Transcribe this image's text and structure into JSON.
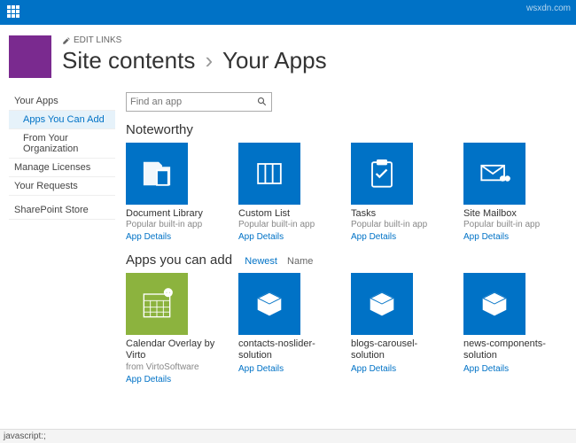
{
  "top_bar": {},
  "header": {
    "edit_links": "EDIT LINKS",
    "breadcrumb_root": "Site contents",
    "breadcrumb_current": "Your Apps"
  },
  "sidebar": {
    "items": [
      {
        "label": "Your Apps"
      },
      {
        "label": "Apps You Can Add"
      },
      {
        "label": "From Your Organization"
      },
      {
        "label": "Manage Licenses"
      },
      {
        "label": "Your Requests"
      },
      {
        "label": "SharePoint Store"
      }
    ]
  },
  "search": {
    "placeholder": "Find an app"
  },
  "sections": {
    "noteworthy": {
      "title": "Noteworthy",
      "apps": [
        {
          "name": "Document Library",
          "sub": "Popular built-in app",
          "link": "App Details"
        },
        {
          "name": "Custom List",
          "sub": "Popular built-in app",
          "link": "App Details"
        },
        {
          "name": "Tasks",
          "sub": "Popular built-in app",
          "link": "App Details"
        },
        {
          "name": "Site Mailbox",
          "sub": "Popular built-in app",
          "link": "App Details"
        }
      ]
    },
    "can_add": {
      "title": "Apps you can add",
      "filter_newest": "Newest",
      "filter_name": "Name",
      "apps": [
        {
          "name": "Calendar Overlay by Virto",
          "sub": "from VirtoSoftware",
          "link": "App Details"
        },
        {
          "name": "contacts-noslider-solution",
          "sub": "",
          "link": "App Details"
        },
        {
          "name": "blogs-carousel-solution",
          "sub": "",
          "link": "App Details"
        },
        {
          "name": "news-components-solution",
          "sub": "",
          "link": "App Details"
        }
      ]
    }
  },
  "status_bar": "javascript:;",
  "watermark": "wsxdn.com"
}
